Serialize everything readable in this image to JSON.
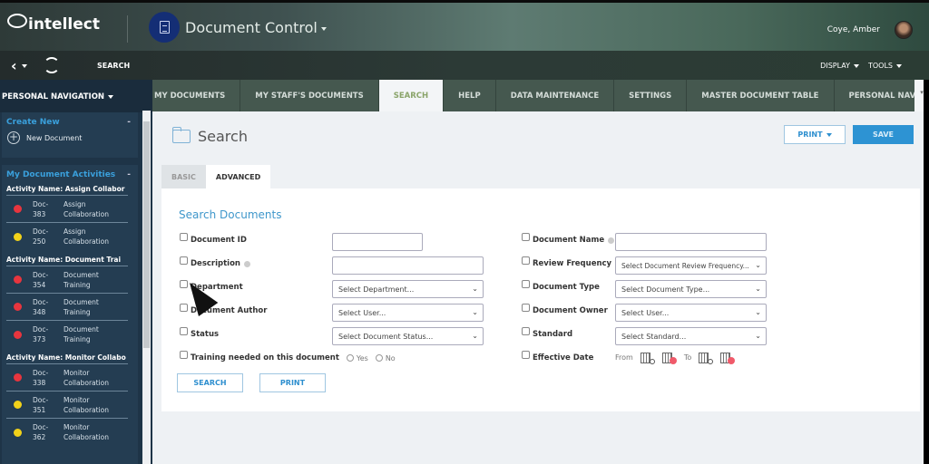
{
  "header": {
    "logo_text": "intellect",
    "app_title": "Document Control",
    "user_name": "Coye, Amber"
  },
  "navbar": {
    "page_label": "SEARCH",
    "display_label": "DISPLAY",
    "tools_label": "TOOLS"
  },
  "sidebar": {
    "header": "PERSONAL NAVIGATION",
    "create_new": {
      "title": "Create New",
      "collapse": "-",
      "items": [
        {
          "label": "New Document",
          "icon": "plus-circle-icon"
        }
      ]
    },
    "activities": {
      "title": "My Document Activities",
      "collapse": "-",
      "groups": [
        {
          "name": "Activity Name: Assign Collabor",
          "items": [
            {
              "doc": "Doc-\n383",
              "doc_prefix": "Doc-",
              "doc_num": "383",
              "line1": "Assign",
              "line2": "Collaboration",
              "status_color": "#e8353e"
            },
            {
              "doc_prefix": "Doc-",
              "doc_num": "250",
              "line1": "Assign",
              "line2": "Collaboration",
              "status_color": "#f2d21a"
            }
          ]
        },
        {
          "name": "Activity Name: Document Trai",
          "items": [
            {
              "doc_prefix": "Doc-",
              "doc_num": "354",
              "line1": "Document",
              "line2": "Training",
              "status_color": "#e8353e"
            },
            {
              "doc_prefix": "Doc-",
              "doc_num": "348",
              "line1": "Document",
              "line2": "Training",
              "status_color": "#e8353e"
            },
            {
              "doc_prefix": "Doc-",
              "doc_num": "373",
              "line1": "Document",
              "line2": "Training",
              "status_color": "#e8353e"
            }
          ]
        },
        {
          "name": "Activity Name: Monitor Collabo",
          "items": [
            {
              "doc_prefix": "Doc-",
              "doc_num": "338",
              "line1": "Monitor",
              "line2": "Collaboration",
              "status_color": "#e8353e"
            },
            {
              "doc_prefix": "Doc-",
              "doc_num": "351",
              "line1": "Monitor",
              "line2": "Collaboration",
              "status_color": "#f2d21a"
            },
            {
              "doc_prefix": "Doc-",
              "doc_num": "362",
              "line1": "Monitor",
              "line2": "Collaboration",
              "status_color": "#f2d21a"
            }
          ]
        }
      ]
    }
  },
  "tabs": [
    {
      "label": "MY DOCUMENTS",
      "active": false
    },
    {
      "label": "MY STAFF'S DOCUMENTS",
      "active": false
    },
    {
      "label": "SEARCH",
      "active": true
    },
    {
      "label": "HELP",
      "active": false
    },
    {
      "label": "DATA MAINTENANCE",
      "active": false
    },
    {
      "label": "SETTINGS",
      "active": false
    },
    {
      "label": "MASTER DOCUMENT TABLE",
      "active": false
    },
    {
      "label": "PERSONAL NAVIGATION",
      "active": false
    }
  ],
  "page": {
    "title": "Search",
    "print_label": "PRINT",
    "save_label": "SAVE",
    "subtabs": [
      {
        "label": "BASIC",
        "active": false
      },
      {
        "label": "ADVANCED",
        "active": true
      }
    ]
  },
  "form": {
    "title": "Search Documents",
    "left": {
      "document_id": {
        "label": "Document ID",
        "value": ""
      },
      "description": {
        "label": "Description",
        "value": ""
      },
      "department": {
        "label": "Department",
        "value": "Select Department..."
      },
      "author": {
        "label": "Document Author",
        "value": "Select User..."
      },
      "status": {
        "label": "Status",
        "value": "Select Document Status..."
      },
      "training": {
        "label": "Training needed on this document",
        "yes": "Yes",
        "no": "No"
      }
    },
    "right": {
      "document_name": {
        "label": "Document Name",
        "value": ""
      },
      "review_frequency": {
        "label": "Review Frequency",
        "value": "Select Document Review Frequency..."
      },
      "document_type": {
        "label": "Document Type",
        "value": "Select Document Type..."
      },
      "owner": {
        "label": "Document Owner",
        "value": "Select User..."
      },
      "standard": {
        "label": "Standard",
        "value": "Select Standard..."
      },
      "effective_date": {
        "label": "Effective Date",
        "from": "From",
        "to": "To"
      }
    },
    "search_button": "SEARCH",
    "print_button": "PRINT"
  }
}
